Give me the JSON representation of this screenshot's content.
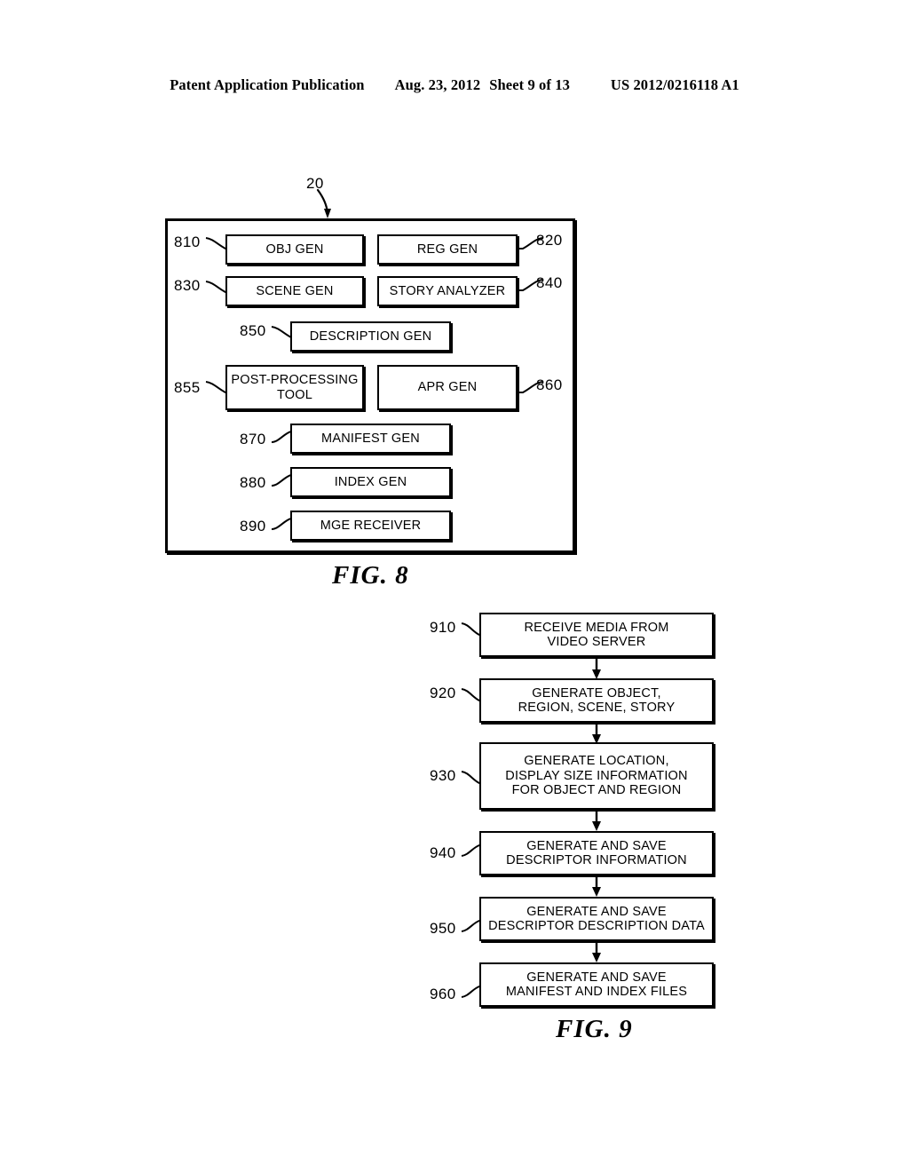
{
  "header": {
    "publication": "Patent Application Publication",
    "date": "Aug. 23, 2012",
    "sheet": "Sheet 9 of 13",
    "patent_number": "US 2012/0216118 A1"
  },
  "figures": [
    {
      "id": "fig8",
      "caption": "FIG. 8",
      "container_ref": "20",
      "nodes": [
        {
          "ref": "810",
          "label": "OBJ GEN"
        },
        {
          "ref": "820",
          "label": "REG GEN"
        },
        {
          "ref": "830",
          "label": "SCENE GEN"
        },
        {
          "ref": "840",
          "label": "STORY ANALYZER"
        },
        {
          "ref": "850",
          "label": "DESCRIPTION GEN"
        },
        {
          "ref": "855",
          "label": "POST-PROCESSING TOOL"
        },
        {
          "ref": "860",
          "label": "APR GEN"
        },
        {
          "ref": "870",
          "label": "MANIFEST GEN"
        },
        {
          "ref": "880",
          "label": "INDEX GEN"
        },
        {
          "ref": "890",
          "label": "MGE RECEIVER"
        }
      ]
    },
    {
      "id": "fig9",
      "caption": "FIG. 9",
      "nodes": [
        {
          "ref": "910",
          "line1": "RECEIVE MEDIA FROM",
          "line2": "VIDEO SERVER",
          "line3": ""
        },
        {
          "ref": "920",
          "line1": "GENERATE OBJECT,",
          "line2": "REGION, SCENE, STORY",
          "line3": ""
        },
        {
          "ref": "930",
          "line1": "GENERATE LOCATION,",
          "line2": "DISPLAY SIZE INFORMATION",
          "line3": "FOR OBJECT AND REGION"
        },
        {
          "ref": "940",
          "line1": "GENERATE AND SAVE",
          "line2": "DESCRIPTOR INFORMATION",
          "line3": ""
        },
        {
          "ref": "950",
          "line1": "GENERATE AND SAVE",
          "line2": "DESCRIPTOR DESCRIPTION DATA",
          "line3": ""
        },
        {
          "ref": "960",
          "line1": "GENERATE AND SAVE",
          "line2": "MANIFEST AND INDEX FILES",
          "line3": ""
        }
      ]
    }
  ],
  "colors": {
    "ink": "#000000",
    "paper": "#ffffff"
  }
}
